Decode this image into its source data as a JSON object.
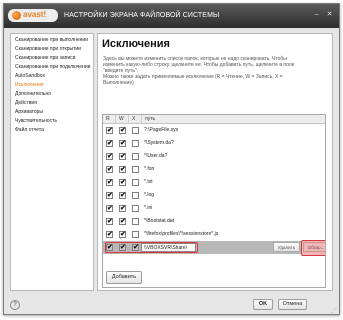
{
  "window": {
    "logo_text": "avast!",
    "title": "НАСТРОЙКИ ЭКРАНА ФАЙЛОВОЙ СИСТЕМЫ",
    "minimize_glyph": "‒",
    "close_glyph": "✕"
  },
  "sidebar": {
    "items": [
      {
        "label": "Сканирование при выполнении"
      },
      {
        "label": "Сканирование при открытии"
      },
      {
        "label": "Сканирование при записи"
      },
      {
        "label": "Сканирование при подключении"
      },
      {
        "label": "AutoSandbox"
      },
      {
        "label": "Исключения"
      },
      {
        "label": "Дополнительно"
      },
      {
        "label": "Действия"
      },
      {
        "label": "Архиваторы"
      },
      {
        "label": "Чувствительность"
      },
      {
        "label": "Файл отчета"
      }
    ],
    "active_index": 5
  },
  "main": {
    "heading": "Исключения",
    "description": [
      "Здесь вы можете изменить список папок, которые не надо сканировать. Чтобы",
      "изменить какую-либо строку, щелкните ее. Чтобы добавить путь, щелкните в поле",
      "\"введите путь\".",
      "Можно также задать применяемые исключения (R = Чтение, W = Запись, X =",
      "Выполнение)"
    ],
    "table": {
      "columns": [
        "R",
        "W",
        "X",
        "путь"
      ],
      "rows": [
        {
          "r": "✔",
          "w": "✔",
          "x": "",
          "path": "?:\\PageFile.sys"
        },
        {
          "r": "✔",
          "w": "✔",
          "x": "",
          "path": "*\\System.da?"
        },
        {
          "r": "✔",
          "w": "✔",
          "x": "",
          "path": "*\\User.da?"
        },
        {
          "r": "✔",
          "w": "✔",
          "x": "",
          "path": "*.fon"
        },
        {
          "r": "✔",
          "w": "✔",
          "x": "",
          "path": "*.txt"
        },
        {
          "r": "✔",
          "w": "✔",
          "x": "",
          "path": "*.log"
        },
        {
          "r": "✔",
          "w": "✔",
          "x": "",
          "path": "*.ini"
        },
        {
          "r": "✔",
          "w": "✔",
          "x": "",
          "path": "*\\Bootstat.dat"
        },
        {
          "r": "✔",
          "w": "✔",
          "x": "",
          "path": "*\\firefox\\profiles\\*\\sessionstore*.js"
        }
      ],
      "edit_row": {
        "r": "✔",
        "w": "✔",
        "x": "✔",
        "value": "\\\\VBOXSVR\\Share\\"
      },
      "delete_label": "Удалить",
      "browse_label": "Обзор..."
    },
    "add_label": "Добавить"
  },
  "footer": {
    "help_glyph": "?",
    "ok_label": "OK",
    "cancel_label": "Отмена",
    "grip_glyph": "⋰"
  },
  "colors": {
    "accent": "#e8790e",
    "highlight": "#e0323a",
    "titlebar": "#3a3a3a"
  }
}
